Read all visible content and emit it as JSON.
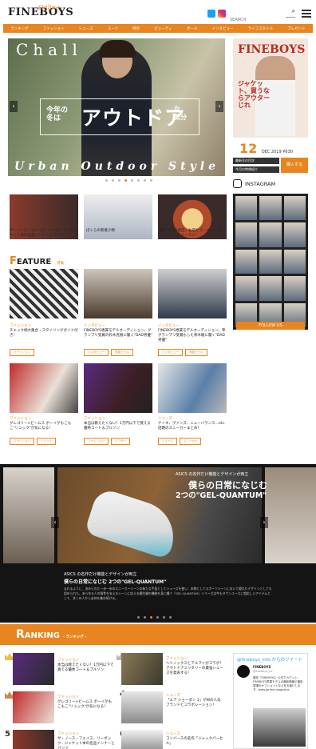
{
  "header": {
    "logo": "FINEBOYS",
    "logo_sub": "Online",
    "search_placeholder": "SEARCH"
  },
  "nav": {
    "items": [
      "ランキング",
      "ファッション",
      "シューズ",
      "スーツ",
      "時計",
      "ビューティ",
      "ボール",
      "インタビュー",
      "ライフスタイル",
      "プレゼント"
    ]
  },
  "hero": {
    "top_text": "Chall",
    "line1": "今年の\n冬は",
    "main": "アウトドア",
    "line3": "な\n気分",
    "bottom_text": "Urban Outdoor Style",
    "prev": "‹",
    "next": "›",
    "dots_count": 8,
    "active_dot": 3
  },
  "magazine": {
    "title": "FINEBOYS",
    "copy": "ジャケット、買うならアウターじれ",
    "date": "12",
    "date_sub": "DEC 2019 ¥630",
    "btn_back": "最新号の目次",
    "btn_present": "今月の特典紹介",
    "btn_buy": "購入する"
  },
  "instagram": {
    "label": "INSTAGRAM",
    "follow": "FOLLOW US"
  },
  "small_tiles": [
    {
      "caption": "ザ・ノース・フェイス、リーボック…ジャケット本の名品インナーとパンツ!"
    },
    {
      "caption": "ぼくらの新着小物"
    },
    {
      "caption": "東京大学の名店、お店とラーメン！カレー！フレンチトースト!"
    }
  ],
  "feature": {
    "initial": "F",
    "rest": "EATURE",
    "sub": "- 特集 -",
    "items": [
      {
        "category": "ファッション",
        "title": "チェック柄大集合・スタイリングガイド付き!",
        "tags": [
          "ファッション"
        ]
      },
      {
        "category": "インタビュー",
        "title": "FINEBOYS専属モデルオーディション、グランプリ受賞の鈴木克樹に聞く\"DAD男優\"",
        "tags": [
          "インタビュー",
          "専属モデル"
        ]
      },
      {
        "category": "インタビュー",
        "title": "FINEBOYS専属モデルオーディション、準グランプリ受賞もした青木駿に聞く\"DAD男優\"",
        "tags": [
          "インタビュー",
          "専属モデル"
        ]
      },
      {
        "category": "ファッション",
        "title": "グレゴリー×ビームス ボーイがもこもこ\"リュック\"が気になる！",
        "tags": [
          "ファッション",
          "リュック"
        ]
      },
      {
        "category": "ファッション",
        "title": "本当は教えたくない！1万円以下で買える優秀コート＆ブルゾン",
        "tags": [
          "ファッション",
          "アウター"
        ]
      },
      {
        "category": "シューズ",
        "title": "ナイキ、ヴァンズ、ニューバランス…etc.話題のスニーカーまとめ！",
        "tags": [
          "シューズ",
          "スニーカー"
        ]
      }
    ]
  },
  "banner": {
    "brand": "ASICS の名作だけ機能とデザインが両立",
    "headline1": "僕らの日常になじむ",
    "headline2": "2つの\"GEL-QUANTUM\"",
    "caption": "ASICS の名作だけ機能とデザインが両立",
    "title": "僕らの日常になじむ 2つの\"GEL-QUANTUM\"",
    "desc": "まれるように、決められた一歩一歩のスニーカーシーンの新たな手段としてシューズを使い、本物としてスポーツシーンにおいて優れたデザインとしても認められた。あらゆる人の個性を支えるシーンに応える最先端の機能を身に纏う『GEL-QUANTUM』シリーズは今もタウンユースに相応しいアイテムとして、多くの人から支持を集め続ける。",
    "dots_count": 6,
    "active_dot": 2
  },
  "ranking": {
    "initial": "R",
    "rest": "ANKING",
    "sub": "- ランキング -",
    "items": [
      {
        "rank": "1",
        "category": "ファッション",
        "title": "本当は教えたくない！1万円以下で買える優秀コート＆ブルゾン"
      },
      {
        "rank": "2",
        "category": "ファッション",
        "title": "ヘリノックスとアルファがコラボ！アウトドアミリタリーの最強シューズを発表する！"
      },
      {
        "rank": "3",
        "category": "ファッション",
        "title": "グレゴリー×ビームス ボーイがもこもこ\"リュック\"が気になる！"
      },
      {
        "rank": "4",
        "category": "シューズ",
        "title": "「エア ジョーダン 1」がWの人気ブランドとコラボレーション！"
      },
      {
        "rank": "5",
        "category": "ファッション",
        "title": "ザ・ノース・フェイス、リーボック…ジャケット本の名品インナーとパンツ"
      },
      {
        "rank": "6",
        "category": "シューズ",
        "title": "コンバースの名作「ジャックパーセル」"
      }
    ]
  },
  "twitter": {
    "head": "@fineboys_info からのツイート",
    "name": "FINEBOYS",
    "handle": "@fineboys_inf",
    "body": "雑誌『FINEBOYS』公式アカウント。FINEBOYS専属モデルの最新情報や撮影現場のオフショットなどをお届けします。www.jprime-magazine"
  },
  "colors": {
    "accent": "#e8851f",
    "dark": "#141414"
  }
}
